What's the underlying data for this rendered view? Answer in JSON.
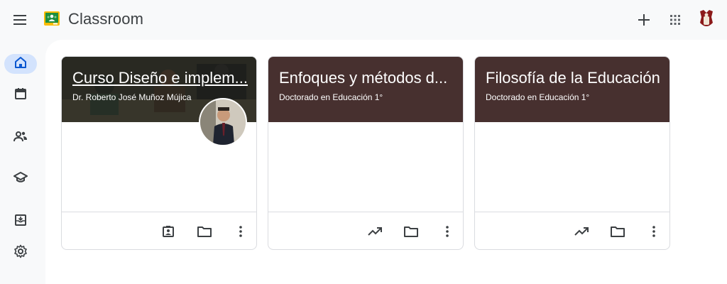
{
  "app": {
    "title": "Classroom",
    "logo_icon": "classroom-logo-icon",
    "brand_color": "#1e8e3e"
  },
  "topbar": {
    "menu_icon": "menu-icon",
    "actions": [
      {
        "name": "add-class-icon"
      },
      {
        "name": "apps-grid-icon"
      },
      {
        "name": "account-avatar"
      }
    ]
  },
  "sidebar": {
    "active_color": "#d3e3fd",
    "items": [
      {
        "icon": "home-icon",
        "active": true
      },
      {
        "icon": "calendar-icon",
        "active": false
      },
      {
        "icon": "people-icon",
        "active": false
      },
      {
        "icon": "school-icon",
        "active": false
      },
      {
        "icon": "archive-icon",
        "active": false
      },
      {
        "icon": "settings-icon",
        "active": false
      }
    ]
  },
  "cards": [
    {
      "title": "Curso Diseño e implem...",
      "subtitle": "Dr. Roberto José Muñoz Mújica",
      "header_color": "#4f4b40",
      "has_avatar": true,
      "actions": [
        "assignment-ind-icon",
        "folder-icon",
        "more-vert-icon"
      ]
    },
    {
      "title": "Enfoques y métodos d...",
      "subtitle": "Doctorado en Educación 1°",
      "header_color": "#47302f",
      "has_avatar": false,
      "actions": [
        "trending-up-icon",
        "folder-icon",
        "more-vert-icon"
      ]
    },
    {
      "title": "Filosofía de la Educación",
      "subtitle": "Doctorado en Educación 1°",
      "header_color": "#47302f",
      "has_avatar": false,
      "actions": [
        "trending-up-icon",
        "folder-icon",
        "more-vert-icon"
      ]
    }
  ]
}
